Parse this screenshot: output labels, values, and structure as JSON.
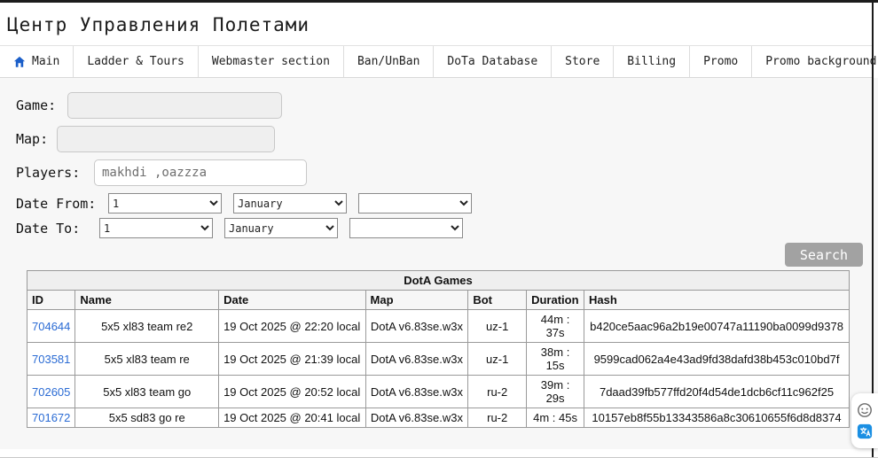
{
  "window": {
    "title": "Центр Управления Полетами"
  },
  "nav": {
    "tabs": [
      {
        "label": "Main",
        "active": true,
        "icon": "home-icon"
      },
      {
        "label": "Ladder & Tours"
      },
      {
        "label": "Webmaster section"
      },
      {
        "label": "Ban/UnBan"
      },
      {
        "label": "DoTa Database"
      },
      {
        "label": "Store"
      },
      {
        "label": "Billing"
      },
      {
        "label": "Promo"
      },
      {
        "label": "Promo background"
      }
    ]
  },
  "form": {
    "game_label": "Game:",
    "map_label": "Map:",
    "players_label": "Players:",
    "players_value": "makhdi ,oazzza",
    "date_from_label": "Date From:",
    "date_to_label": "Date To:",
    "date_from": {
      "day": "1",
      "month": "January",
      "year": ""
    },
    "date_to": {
      "day": "1",
      "month": "January",
      "year": ""
    },
    "search_label": "Search"
  },
  "table": {
    "caption": "DotA Games",
    "columns": [
      "ID",
      "Name",
      "Date",
      "Map",
      "Bot",
      "Duration",
      "Hash"
    ],
    "rows": [
      [
        "704644",
        "5x5 xl83 team re2",
        "19 Oct 2025 @ 22:20 local",
        "DotA v6.83se.w3x",
        "uz-1",
        "44m : 37s",
        "b420ce5aac96a2b19e00747a11190ba0099d9378"
      ],
      [
        "703581",
        "5x5 xl83 team re",
        "19 Oct 2025 @ 21:39 local",
        "DotA v6.83se.w3x",
        "uz-1",
        "38m : 15s",
        "9599cad062a4e43ad9fd38dafd38b453c010bd7f"
      ],
      [
        "702605",
        "5x5 xl83 team go",
        "19 Oct 2025 @ 20:52 local",
        "DotA v6.83se.w3x",
        "ru-2",
        "39m : 29s",
        "7daad39fb577ffd20f4d54de1dcb6cf11c962f25"
      ],
      [
        "701672",
        "5x5 sd83 go re",
        "19 Oct 2025 @ 20:41 local",
        "DotA v6.83se.w3x",
        "ru-2",
        "4m : 45s",
        "10157eb8f55b13343586a8c30610655f6d8d8374"
      ]
    ]
  },
  "colors": {
    "accent_blue": "#1b5fc9",
    "link_blue": "#2a6bd4",
    "edge_black": "#1c1c1c"
  }
}
